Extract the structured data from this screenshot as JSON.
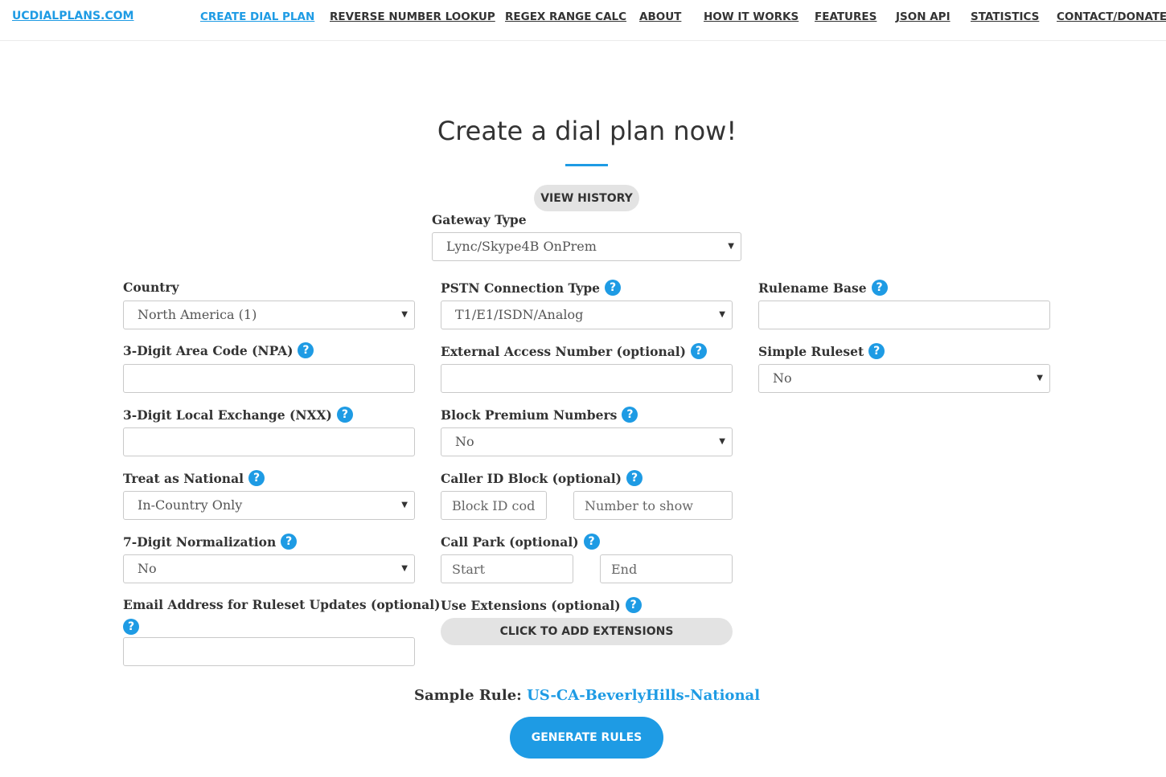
{
  "nav": {
    "logo": "UCDIALPLANS.COM",
    "links": [
      "CREATE DIAL PLAN",
      "REVERSE NUMBER LOOKUP",
      "REGEX RANGE CALC",
      "ABOUT",
      "HOW IT WORKS",
      "FEATURES",
      "JSON API",
      "STATISTICS",
      "CONTACT/DONATE"
    ],
    "active_link": "CREATE DIAL PLAN"
  },
  "page": {
    "title": "Create a dial plan now!",
    "view_history": "VIEW HISTORY",
    "help_glyph": "?",
    "accent_color": "#1e9be4"
  },
  "form": {
    "gateway_type": {
      "label": "Gateway Type",
      "value": "Lync/Skype4B OnPrem"
    },
    "country": {
      "label": "Country",
      "value": "North America (1)"
    },
    "area_code": {
      "label": "3-Digit Area Code (NPA)",
      "value": ""
    },
    "local_exchange": {
      "label": "3-Digit Local Exchange (NXX)",
      "value": ""
    },
    "treat_national": {
      "label": "Treat as National",
      "value": "In-Country Only"
    },
    "seven_digit": {
      "label": "7-Digit Normalization",
      "value": "No"
    },
    "email": {
      "label": "Email Address for Ruleset Updates (optional)",
      "value": ""
    },
    "pstn_type": {
      "label": "PSTN Connection Type",
      "value": "T1/E1/ISDN/Analog"
    },
    "external_access": {
      "label": "External Access Number (optional)",
      "value": ""
    },
    "block_premium": {
      "label": "Block Premium Numbers",
      "value": "No"
    },
    "caller_id": {
      "label": "Caller ID Block (optional)",
      "block_placeholder": "Block ID code",
      "show_placeholder": "Number to show"
    },
    "call_park": {
      "label": "Call Park (optional)",
      "start_placeholder": "Start",
      "end_placeholder": "End"
    },
    "extensions": {
      "label": "Use Extensions (optional)",
      "button": "CLICK TO ADD EXTENSIONS"
    },
    "rulename_base": {
      "label": "Rulename Base",
      "value": ""
    },
    "simple_ruleset": {
      "label": "Simple Ruleset",
      "value": "No"
    }
  },
  "sample_rule": {
    "label": "Sample Rule:",
    "value": "US-CA-BeverlyHills-National"
  },
  "generate_button": "GENERATE RULES"
}
